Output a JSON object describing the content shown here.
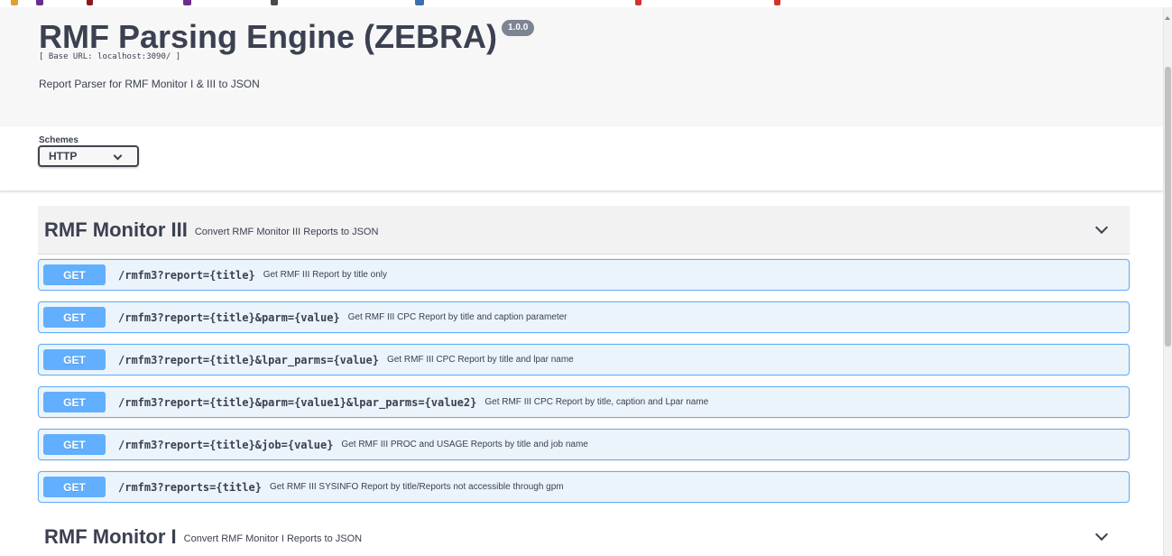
{
  "colors": {
    "get_accent": "#61affe",
    "get_background": "#ebf3fb",
    "text": "#3b4151",
    "info_background": "#f7f7f7",
    "version_badge": "#7d8492"
  },
  "info": {
    "title": "RMF Parsing Engine (ZEBRA)",
    "version": "1.0.0",
    "base_url": "[ Base URL: localhost:3090/ ]",
    "description": "Report Parser for RMF Monitor I & III to JSON"
  },
  "schemes": {
    "label": "Schemes",
    "selected": "HTTP",
    "icon": "chevron-down-icon"
  },
  "tags": [
    {
      "name": "RMF Monitor III",
      "description": "Convert RMF Monitor III Reports to JSON",
      "icon": "chevron-down-icon"
    },
    {
      "name": "RMF Monitor I",
      "description": "Convert RMF Monitor I Reports to JSON",
      "icon": "chevron-down-icon"
    }
  ],
  "operations": [
    {
      "method": "GET",
      "path": "/rmfm3?report={title}",
      "summary": "Get RMF III Report by title only"
    },
    {
      "method": "GET",
      "path": "/rmfm3?report={title}&parm={value}",
      "summary": "Get RMF III CPC Report by title and caption parameter"
    },
    {
      "method": "GET",
      "path": "/rmfm3?report={title}&lpar_parms={value}",
      "summary": "Get RMF III CPC Report by title and lpar name"
    },
    {
      "method": "GET",
      "path": "/rmfm3?report={title}&parm={value1}&lpar_parms={value2}",
      "summary": "Get RMF III CPC Report by title, caption and Lpar name"
    },
    {
      "method": "GET",
      "path": "/rmfm3?report={title}&job={value}",
      "summary": "Get RMF III PROC and USAGE Reports by title and job name"
    },
    {
      "method": "GET",
      "path": "/rmfm3?reports={title}",
      "summary": "Get RMF III SYSINFO Report by title/Reports not accessible through gpm"
    }
  ]
}
